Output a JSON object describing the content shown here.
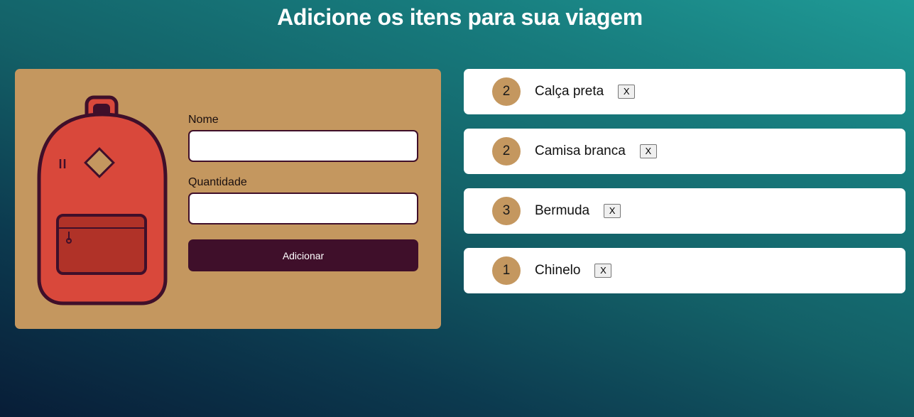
{
  "header": {
    "title": "Adicione os itens para sua viagem"
  },
  "form": {
    "name_label": "Nome",
    "name_value": "",
    "quantity_label": "Quantidade",
    "quantity_value": "",
    "submit_label": "Adicionar",
    "illustration_icon": "backpack-icon"
  },
  "items": [
    {
      "quantity": "2",
      "name": "Calça preta",
      "remove_label": "X"
    },
    {
      "quantity": "2",
      "name": "Camisa branca",
      "remove_label": "X"
    },
    {
      "quantity": "3",
      "name": "Bermuda",
      "remove_label": "X"
    },
    {
      "quantity": "1",
      "name": "Chinelo",
      "remove_label": "X"
    }
  ],
  "colors": {
    "card": "#c4975f",
    "primary": "#3f0f2a",
    "backpack_body": "#d9483b",
    "backpack_pocket": "#b03228",
    "background_top": "#1f9a96",
    "background_bottom": "#081d37"
  }
}
